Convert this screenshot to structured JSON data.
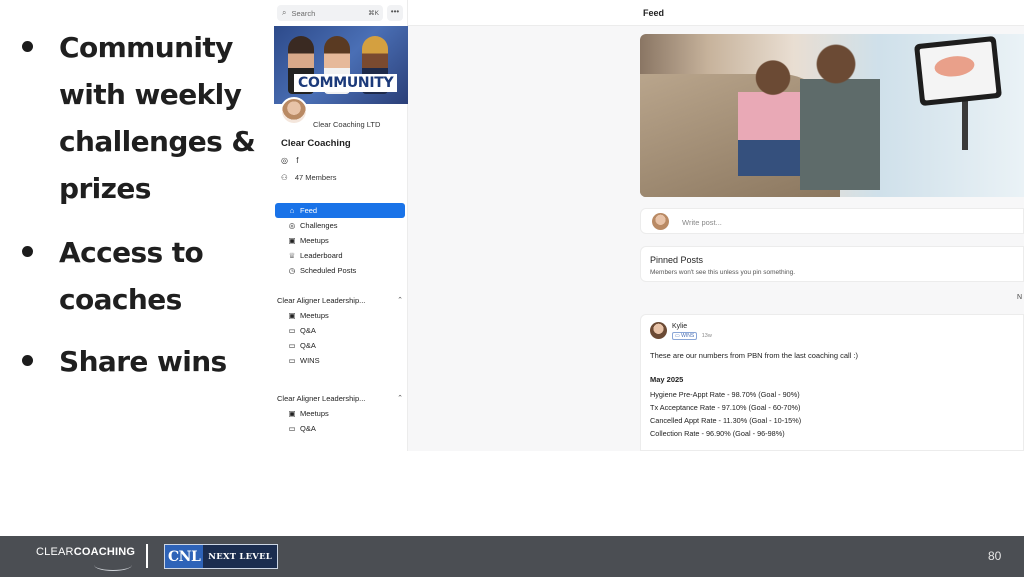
{
  "bullets": [
    {
      "text": "Community with weekly challenges & prizes"
    },
    {
      "text": "Access to coaches"
    },
    {
      "text": "Share wins"
    }
  ],
  "app": {
    "search": {
      "placeholder": "Search",
      "shortcut": "⌘K"
    },
    "more_icon": "more-dots-icon",
    "banner": {
      "word": "COMMUNITY"
    },
    "org_name": "Clear Coaching LTD",
    "community_name": "Clear Coaching",
    "social": {
      "instagram_icon": "instagram-icon",
      "facebook_icon": "facebook-icon"
    },
    "members": "47 Members",
    "nav": [
      {
        "label": "Feed",
        "icon": "home-icon",
        "active": true
      },
      {
        "label": "Challenges",
        "icon": "target-icon"
      },
      {
        "label": "Meetups",
        "icon": "calendar-icon"
      },
      {
        "label": "Leaderboard",
        "icon": "trophy-icon"
      },
      {
        "label": "Scheduled Posts",
        "icon": "clock-icon"
      }
    ],
    "groups": [
      {
        "title": "Clear Aligner Leadership...",
        "items": [
          {
            "label": "Meetups",
            "icon": "calendar-icon"
          },
          {
            "label": "Q&A",
            "icon": "monitor-icon"
          },
          {
            "label": "Q&A",
            "icon": "monitor-icon"
          },
          {
            "label": "WINS",
            "icon": "monitor-icon"
          }
        ]
      },
      {
        "title": "Clear Aligner Leadership...",
        "items": [
          {
            "label": "Meetups",
            "icon": "calendar-icon"
          },
          {
            "label": "Q&A",
            "icon": "monitor-icon"
          }
        ]
      }
    ],
    "feed": {
      "title": "Feed",
      "composer_placeholder": "Write post...",
      "pinned_title": "Pinned Posts",
      "pinned_subtitle": "Members won't see this unless you pin something.",
      "stray": "N",
      "post": {
        "author": "Kylie",
        "channel": "WINS",
        "age": "13w",
        "body": "These are our numbers from PBN from the last coaching call :)",
        "month": "May 2025",
        "stats": [
          "Hygiene Pre-Appt Rate - 98.70% (Goal - 90%)",
          "Tx Acceptance Rate - 97.10% (Goal - 60-70%)",
          "Cancelled Appt Rate - 11.30% (Goal - 10-15%)",
          "Collection Rate - 96.90% (Goal - 96-98%)"
        ]
      }
    }
  },
  "footer": {
    "logo_left_a": "CLEAR",
    "logo_left_b": "COACHING",
    "logo_right_a": "CNL",
    "logo_right_b": "NEXT LEVEL",
    "page_number": "80",
    "background": "#4b4e53"
  }
}
